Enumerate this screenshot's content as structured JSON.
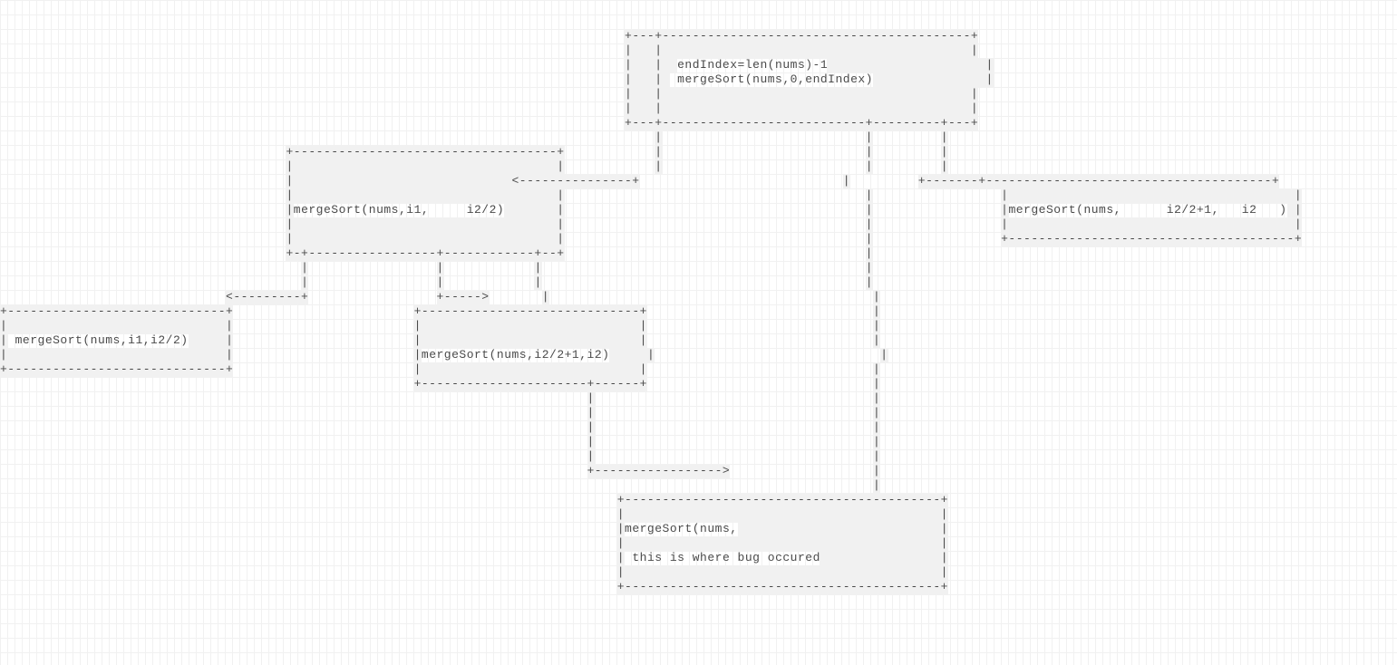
{
  "diagram": {
    "root": {
      "line1": "endIndex=len(nums)-1",
      "line2": "mergeSort(nums,0,endIndex)"
    },
    "left_child": {
      "label": "mergeSort(nums,i1,     i2/2)"
    },
    "right_child": {
      "label": "mergeSort(nums,      i2/2+1,   i2   )"
    },
    "left_left_grandchild": {
      "label": "mergeSort(nums,i1,i2/2)"
    },
    "left_right_grandchild": {
      "label": "mergeSort(nums,i2/2+1,i2)"
    },
    "bug_node": {
      "line1": "mergeSort(nums,",
      "line2": "this is where bug occured"
    }
  }
}
